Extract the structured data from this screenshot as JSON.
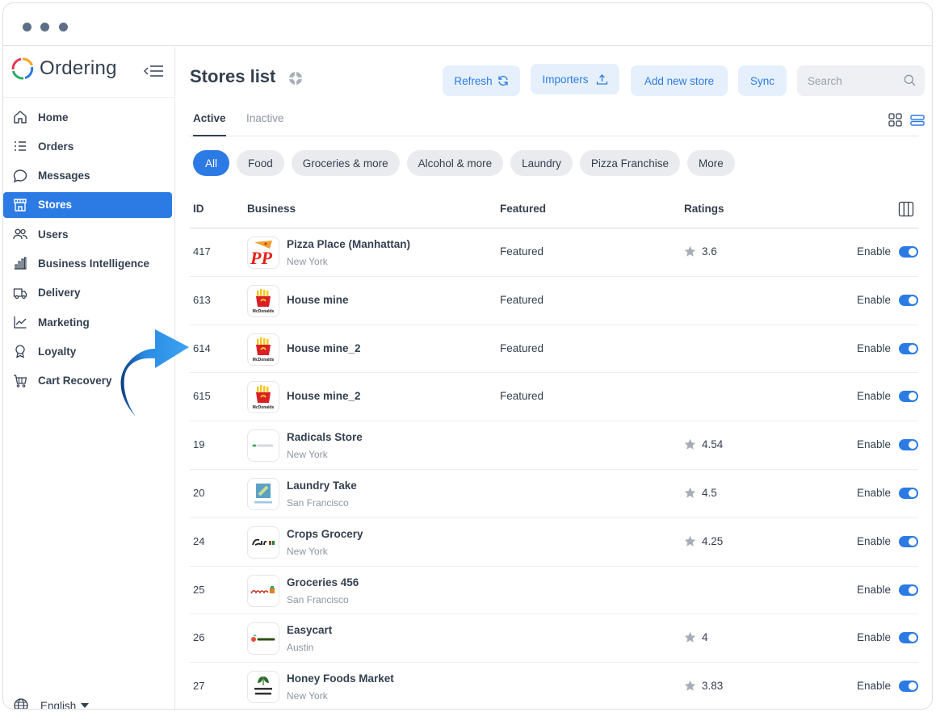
{
  "sidebar": {
    "brand": "Ordering",
    "items": [
      {
        "label": "Home",
        "icon": "home-icon"
      },
      {
        "label": "Orders",
        "icon": "orders-list-icon"
      },
      {
        "label": "Messages",
        "icon": "message-icon"
      },
      {
        "label": "Stores",
        "icon": "store-icon",
        "active": true
      },
      {
        "label": "Users",
        "icon": "users-icon"
      },
      {
        "label": "Business Intelligence",
        "icon": "bar-chart-icon"
      },
      {
        "label": "Delivery",
        "icon": "truck-icon"
      },
      {
        "label": "Marketing",
        "icon": "trend-line-icon"
      },
      {
        "label": "Loyalty",
        "icon": "award-icon"
      },
      {
        "label": "Cart Recovery",
        "icon": "cart-icon"
      }
    ],
    "language": "English"
  },
  "header": {
    "title": "Stores list",
    "buttons": {
      "refresh": "Refresh",
      "importers": "Importers",
      "add_store": "Add new store",
      "sync": "Sync"
    },
    "search_placeholder": "Search"
  },
  "tabs": {
    "active": "Active",
    "inactive": "Inactive"
  },
  "filters": [
    "All",
    "Food",
    "Groceries & more",
    "Alcohol & more",
    "Laundry",
    "Pizza Franchise",
    "More"
  ],
  "table": {
    "columns": {
      "id": "ID",
      "business": "Business",
      "featured": "Featured",
      "ratings": "Ratings"
    },
    "rows": [
      {
        "id": "417",
        "name": "Pizza Place (Manhattan)",
        "city": "New York",
        "featured": "Featured",
        "rating": "3.6",
        "status": "Enable",
        "logo": "pizza-place-logo"
      },
      {
        "id": "613",
        "name": "House mine",
        "city": "",
        "featured": "Featured",
        "rating": "",
        "status": "Enable",
        "logo": "mcdonalds-logo"
      },
      {
        "id": "614",
        "name": "House mine_2",
        "city": "",
        "featured": "Featured",
        "rating": "",
        "status": "Enable",
        "logo": "mcdonalds-logo"
      },
      {
        "id": "615",
        "name": "House mine_2",
        "city": "",
        "featured": "Featured",
        "rating": "",
        "status": "Enable",
        "logo": "mcdonalds-logo"
      },
      {
        "id": "19",
        "name": "Radicals Store",
        "city": "New York",
        "featured": "",
        "rating": "4.54",
        "status": "Enable",
        "logo": "radicals-logo"
      },
      {
        "id": "20",
        "name": "Laundry Take",
        "city": "San Francisco",
        "featured": "",
        "rating": "4.5",
        "status": "Enable",
        "logo": "laundry-take-logo"
      },
      {
        "id": "24",
        "name": "Crops Grocery",
        "city": "New York",
        "featured": "",
        "rating": "4.25",
        "status": "Enable",
        "logo": "crops-logo"
      },
      {
        "id": "25",
        "name": "Groceries 456",
        "city": "San Francisco",
        "featured": "",
        "rating": "",
        "status": "Enable",
        "logo": "groceries-logo"
      },
      {
        "id": "26",
        "name": "Easycart",
        "city": "Austin",
        "featured": "",
        "rating": "4",
        "status": "Enable",
        "logo": "easycart-logo"
      },
      {
        "id": "27",
        "name": "Honey Foods Market",
        "city": "New York",
        "featured": "",
        "rating": "3.83",
        "status": "Enable",
        "logo": "honey-foods-logo"
      }
    ]
  },
  "colors": {
    "accent": "#2c7be5",
    "text": "#344050",
    "muted": "#8d96a3",
    "chip_bg": "#e9ebee",
    "button_bg": "#e6f0fc"
  }
}
